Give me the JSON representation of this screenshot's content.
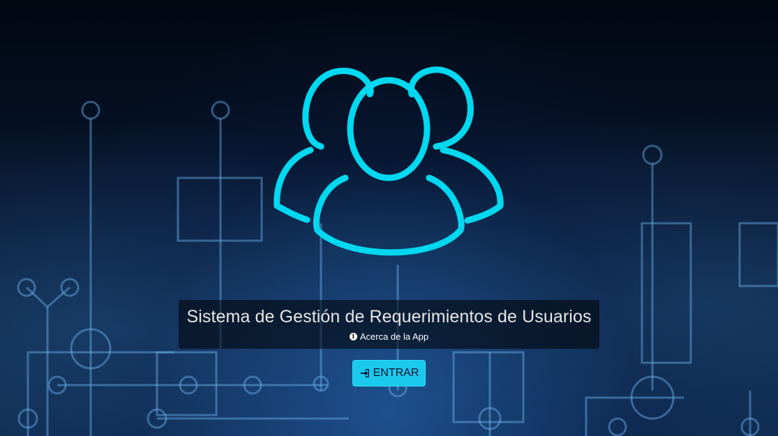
{
  "page": {
    "title": "Sistema de Gestión de Requerimientos de Usuarios",
    "about_link": "Acerca de la App",
    "enter_button": "ENTRAR"
  },
  "icons": {
    "logo": "users-group-icon",
    "about": "info-circle-icon",
    "enter": "sign-in-icon"
  },
  "colors": {
    "accent": "#00d8f0",
    "button": "#1ac9ec",
    "background": "#05101f"
  }
}
